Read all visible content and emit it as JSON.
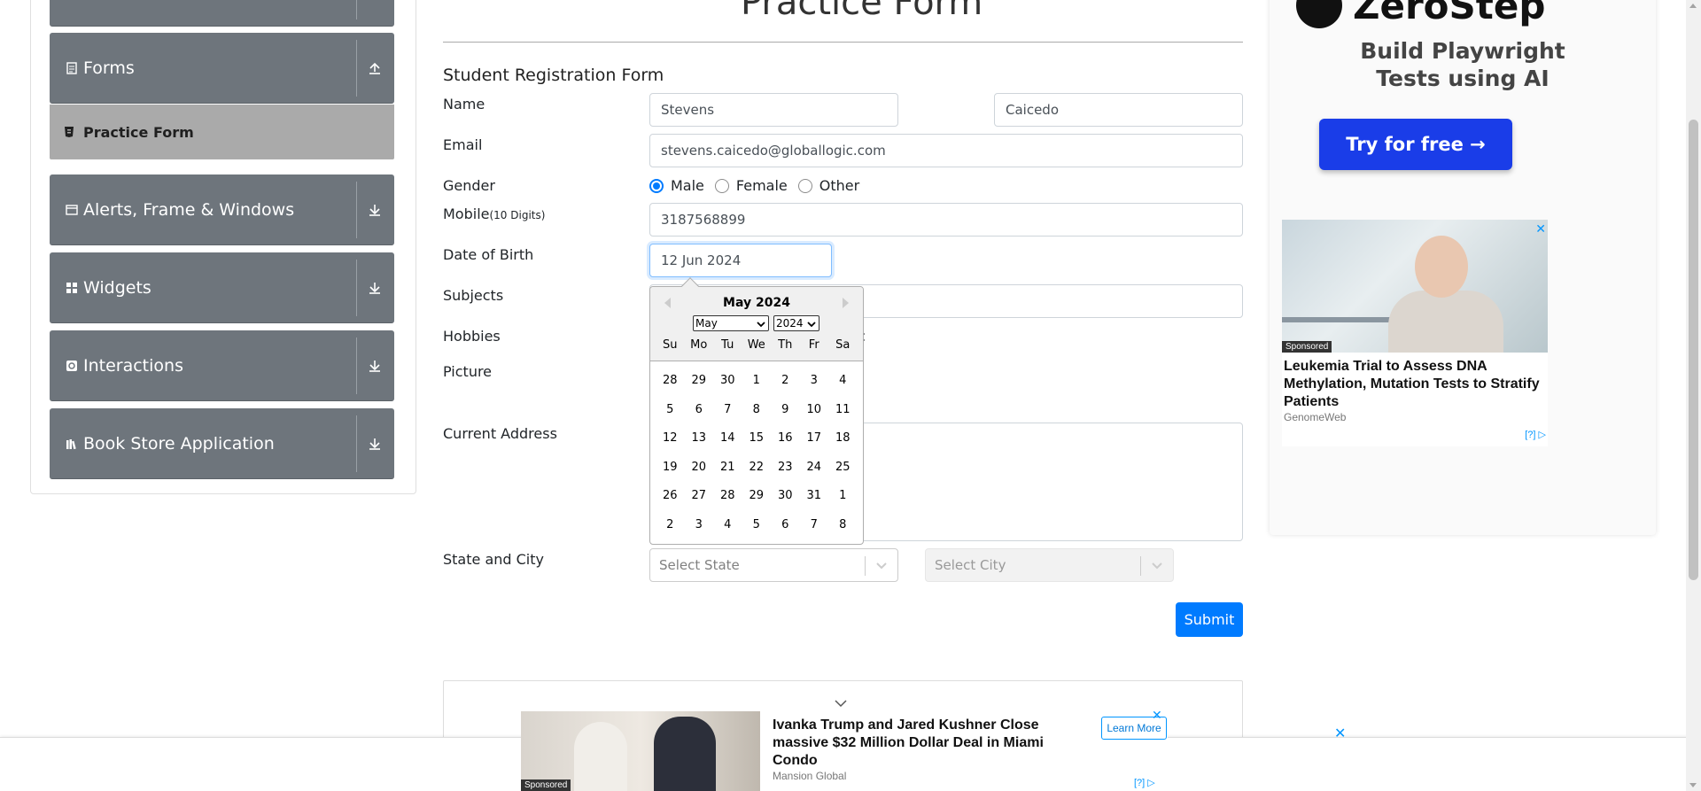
{
  "sidebar": {
    "groups": [
      {
        "label": "",
        "icon": "collapsed-group-icon"
      },
      {
        "label": "Forms",
        "icon": "form-icon"
      },
      {
        "label": "Alerts, Frame & Windows",
        "icon": "window-icon"
      },
      {
        "label": "Widgets",
        "icon": "widgets-icon"
      },
      {
        "label": "Interactions",
        "icon": "interactions-icon"
      },
      {
        "label": "Book Store Application",
        "icon": "books-icon"
      }
    ],
    "active_item": "Practice Form"
  },
  "main": {
    "title": "Practice Form",
    "form_heading": "Student Registration Form",
    "labels": {
      "name": "Name",
      "email": "Email",
      "gender": "Gender",
      "mobile": "Mobile",
      "mobile_hint": "(10 Digits)",
      "dob": "Date of Birth",
      "subjects": "Subjects",
      "hobbies": "Hobbies",
      "picture": "Picture",
      "address": "Current Address",
      "state_city": "State and City"
    },
    "values": {
      "first_name": "Stevens",
      "last_name": "Caicedo",
      "email": "stevens.caicedo@globallogic.com",
      "mobile": "3187568899",
      "dob": "12 Jun 2024",
      "hobbies_tail": "c"
    },
    "gender_options": [
      "Male",
      "Female",
      "Other"
    ],
    "gender_selected": "Male",
    "state_placeholder": "Select State",
    "city_placeholder": "Select City",
    "submit_label": "Submit"
  },
  "datepicker": {
    "month_label": "May 2024",
    "month_select": "May",
    "year_select": "2024",
    "weekdays": [
      "Su",
      "Mo",
      "Tu",
      "We",
      "Th",
      "Fr",
      "Sa"
    ],
    "weeks": [
      [
        "28",
        "29",
        "30",
        "1",
        "2",
        "3",
        "4"
      ],
      [
        "5",
        "6",
        "7",
        "8",
        "9",
        "10",
        "11"
      ],
      [
        "12",
        "13",
        "14",
        "15",
        "16",
        "17",
        "18"
      ],
      [
        "19",
        "20",
        "21",
        "22",
        "23",
        "24",
        "25"
      ],
      [
        "26",
        "27",
        "28",
        "29",
        "30",
        "31",
        "1"
      ],
      [
        "2",
        "3",
        "4",
        "5",
        "6",
        "7",
        "8"
      ]
    ]
  },
  "right_ad": {
    "brand": "ZeroStep",
    "tagline_line1": "Build Playwright",
    "tagline_line2": "Tests using AI",
    "cta": "Try for free →",
    "sponsored_label": "Sponsored",
    "headline": "Leukemia Trial to Assess DNA Methylation, Mutation Tests to Stratify Patients",
    "source": "GenomeWeb",
    "adchoice": "[?]"
  },
  "bottom_ad": {
    "sponsored_label": "Sponsored",
    "headline": "Ivanka Trump and Jared Kushner Close massive $32 Million Dollar Deal in Miami Condo",
    "source": "Mansion Global",
    "learn_more": "Learn More",
    "adchoice": "[?]"
  },
  "colors": {
    "primary": "#007bff",
    "sidebar_group": "#6e757c",
    "sidebar_active": "#aaaaaa",
    "ad_button": "#1a3de8"
  }
}
